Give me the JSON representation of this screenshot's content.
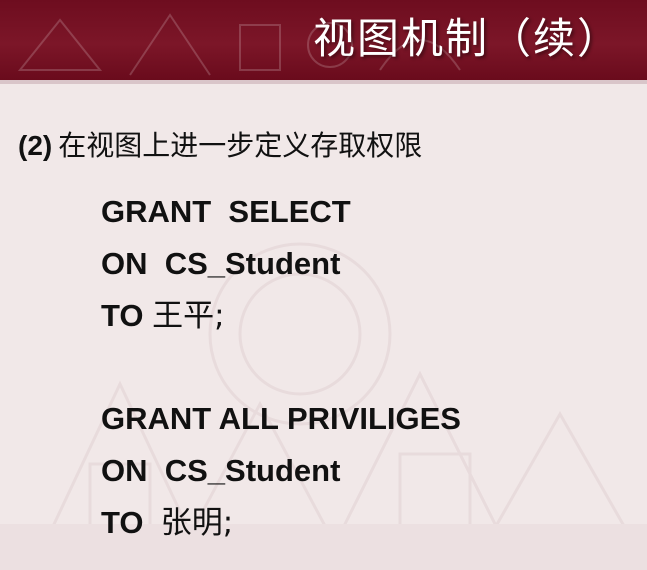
{
  "header": {
    "title": "视图机制（续）"
  },
  "section": {
    "number": "(2)",
    "title": "在视图上进一步定义存取权限"
  },
  "statements": [
    {
      "line1": "GRANT  SELECT",
      "line2": "ON  CS_Student",
      "line3_keyword": "TO ",
      "line3_user": "王平;"
    },
    {
      "line1": "GRANT ALL PRIVILIGES",
      "line2": "ON  CS_Student",
      "line3_keyword": "TO  ",
      "line3_user": "张明;"
    }
  ],
  "colors": {
    "header_bg": "#7c1628",
    "body_bg": "#f1e8e8",
    "text": "#111111"
  }
}
